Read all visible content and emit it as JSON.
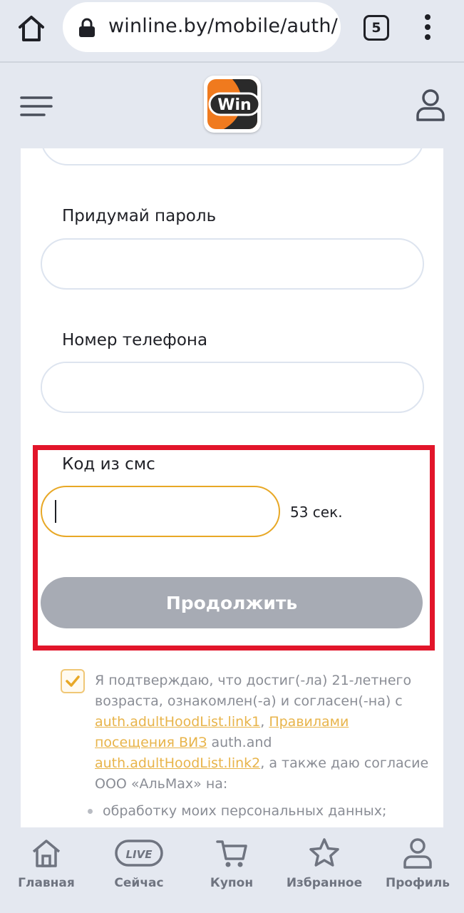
{
  "browser": {
    "url": "winline.by/mobile/auth/",
    "tab_count": "5"
  },
  "header": {
    "logo_text": "Win",
    "colors": {
      "brand_orange": "#f07a1e",
      "brand_dark": "#2a2a2a"
    }
  },
  "form": {
    "password_label": "Придумай пароль",
    "phone_label": "Номер телефона",
    "sms_label": "Код из смс",
    "sms_value": "",
    "sms_timer": "53 сек.",
    "continue_label": "Продолжить"
  },
  "consent": {
    "checked": true,
    "text_1": "Я подтверждаю, что достиг(-ла) 21-летнего возраста, ознакомлен(-а) и согласен(-на) с ",
    "link_1": "auth.adultHoodList.link1",
    "sep_1": ", ",
    "link_2": "Правилами посещения ВИЗ",
    "text_2": " auth.and ",
    "link_3": "auth.adultHoodList.link2",
    "text_3": ", а также даю согласие ООО «АльМах» на:",
    "bullet_1": "обработку моих персональных данных;"
  },
  "bottom_nav": {
    "items": [
      {
        "label": "Главная",
        "icon": "home-icon"
      },
      {
        "label": "Сейчас",
        "icon": "live-icon",
        "badge": "LIVE"
      },
      {
        "label": "Купон",
        "icon": "cart-icon"
      },
      {
        "label": "Избранное",
        "icon": "star-icon"
      },
      {
        "label": "Профиль",
        "icon": "profile-icon"
      }
    ]
  },
  "highlight_color": "#e2152a"
}
